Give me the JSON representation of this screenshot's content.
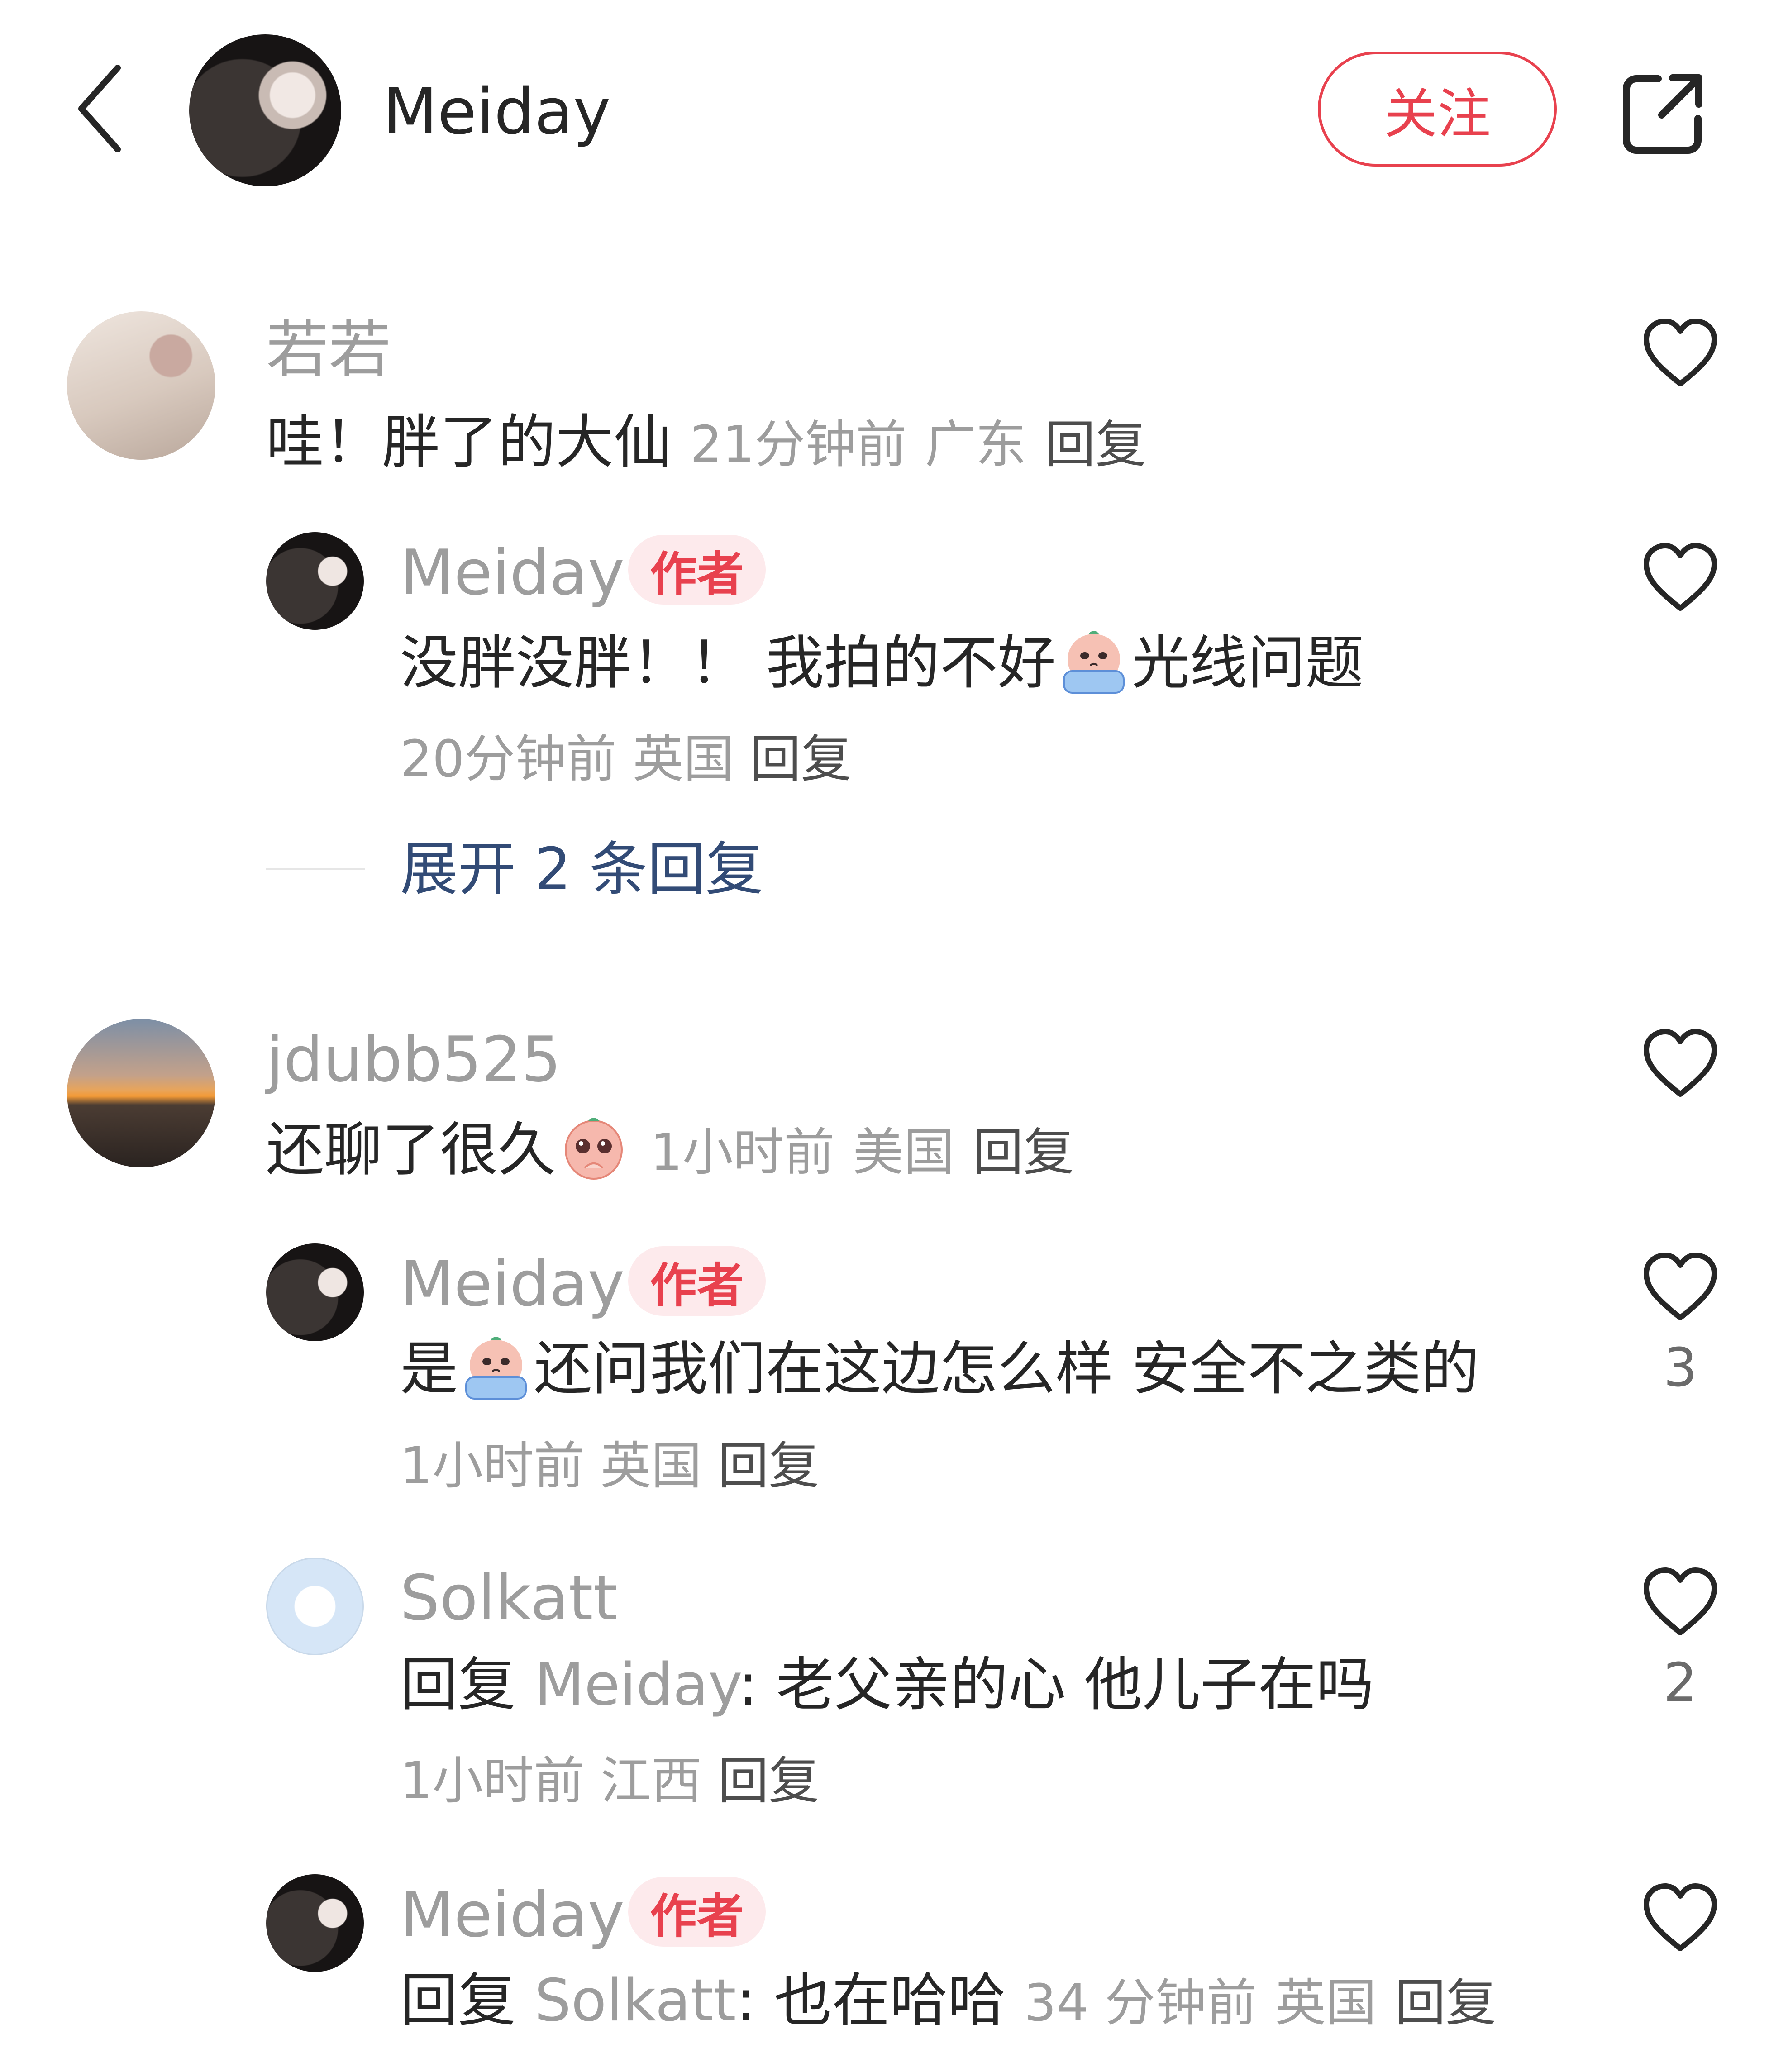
{
  "header": {
    "username": "Meiday",
    "follow_label": "关注"
  },
  "colors": {
    "accent": "#e8414e",
    "meta_gray": "#9d9d9d",
    "link_blue": "#324b76"
  },
  "comments": [
    {
      "username": "若若",
      "text": "哇！胖了的大仙",
      "time": "21分钟前",
      "location": "广东",
      "reply_label": "回复",
      "replies": [
        {
          "username": "Meiday",
          "badge": "作者",
          "text_before_emoji": "没胖没胖！！ 我拍的不好",
          "emoji": "crying-emoji",
          "text_after_emoji": "光线问题",
          "time": "20分钟前",
          "location": "英国",
          "reply_label": "回复"
        }
      ],
      "expand_label": "展开 2 条回复"
    },
    {
      "username": "jdubb525",
      "text": "还聊了很久",
      "emoji": "pleading-emoji",
      "time": "1小时前",
      "location": "美国",
      "reply_label": "回复",
      "replies": [
        {
          "username": "Meiday",
          "badge": "作者",
          "text_before_emoji": "是",
          "emoji": "crying-emoji",
          "text_after_emoji": "还问我们在这边怎么样 安全不之类的",
          "time": "1小时前",
          "location": "英国",
          "reply_label": "回复",
          "likes": "3"
        },
        {
          "username": "Solkatt",
          "reply_prefix": "回复",
          "mention": "Meiday",
          "text": ": 老父亲的心 他儿子在吗",
          "time": "1小时前",
          "location": "江西",
          "reply_label": "回复",
          "likes": "2"
        },
        {
          "username": "Meiday",
          "badge": "作者",
          "reply_prefix": "回复",
          "mention": "Solkatt",
          "text": ": 也在哈哈",
          "time": "34 分钟前",
          "location": "英国",
          "reply_label": "回复"
        }
      ]
    }
  ]
}
